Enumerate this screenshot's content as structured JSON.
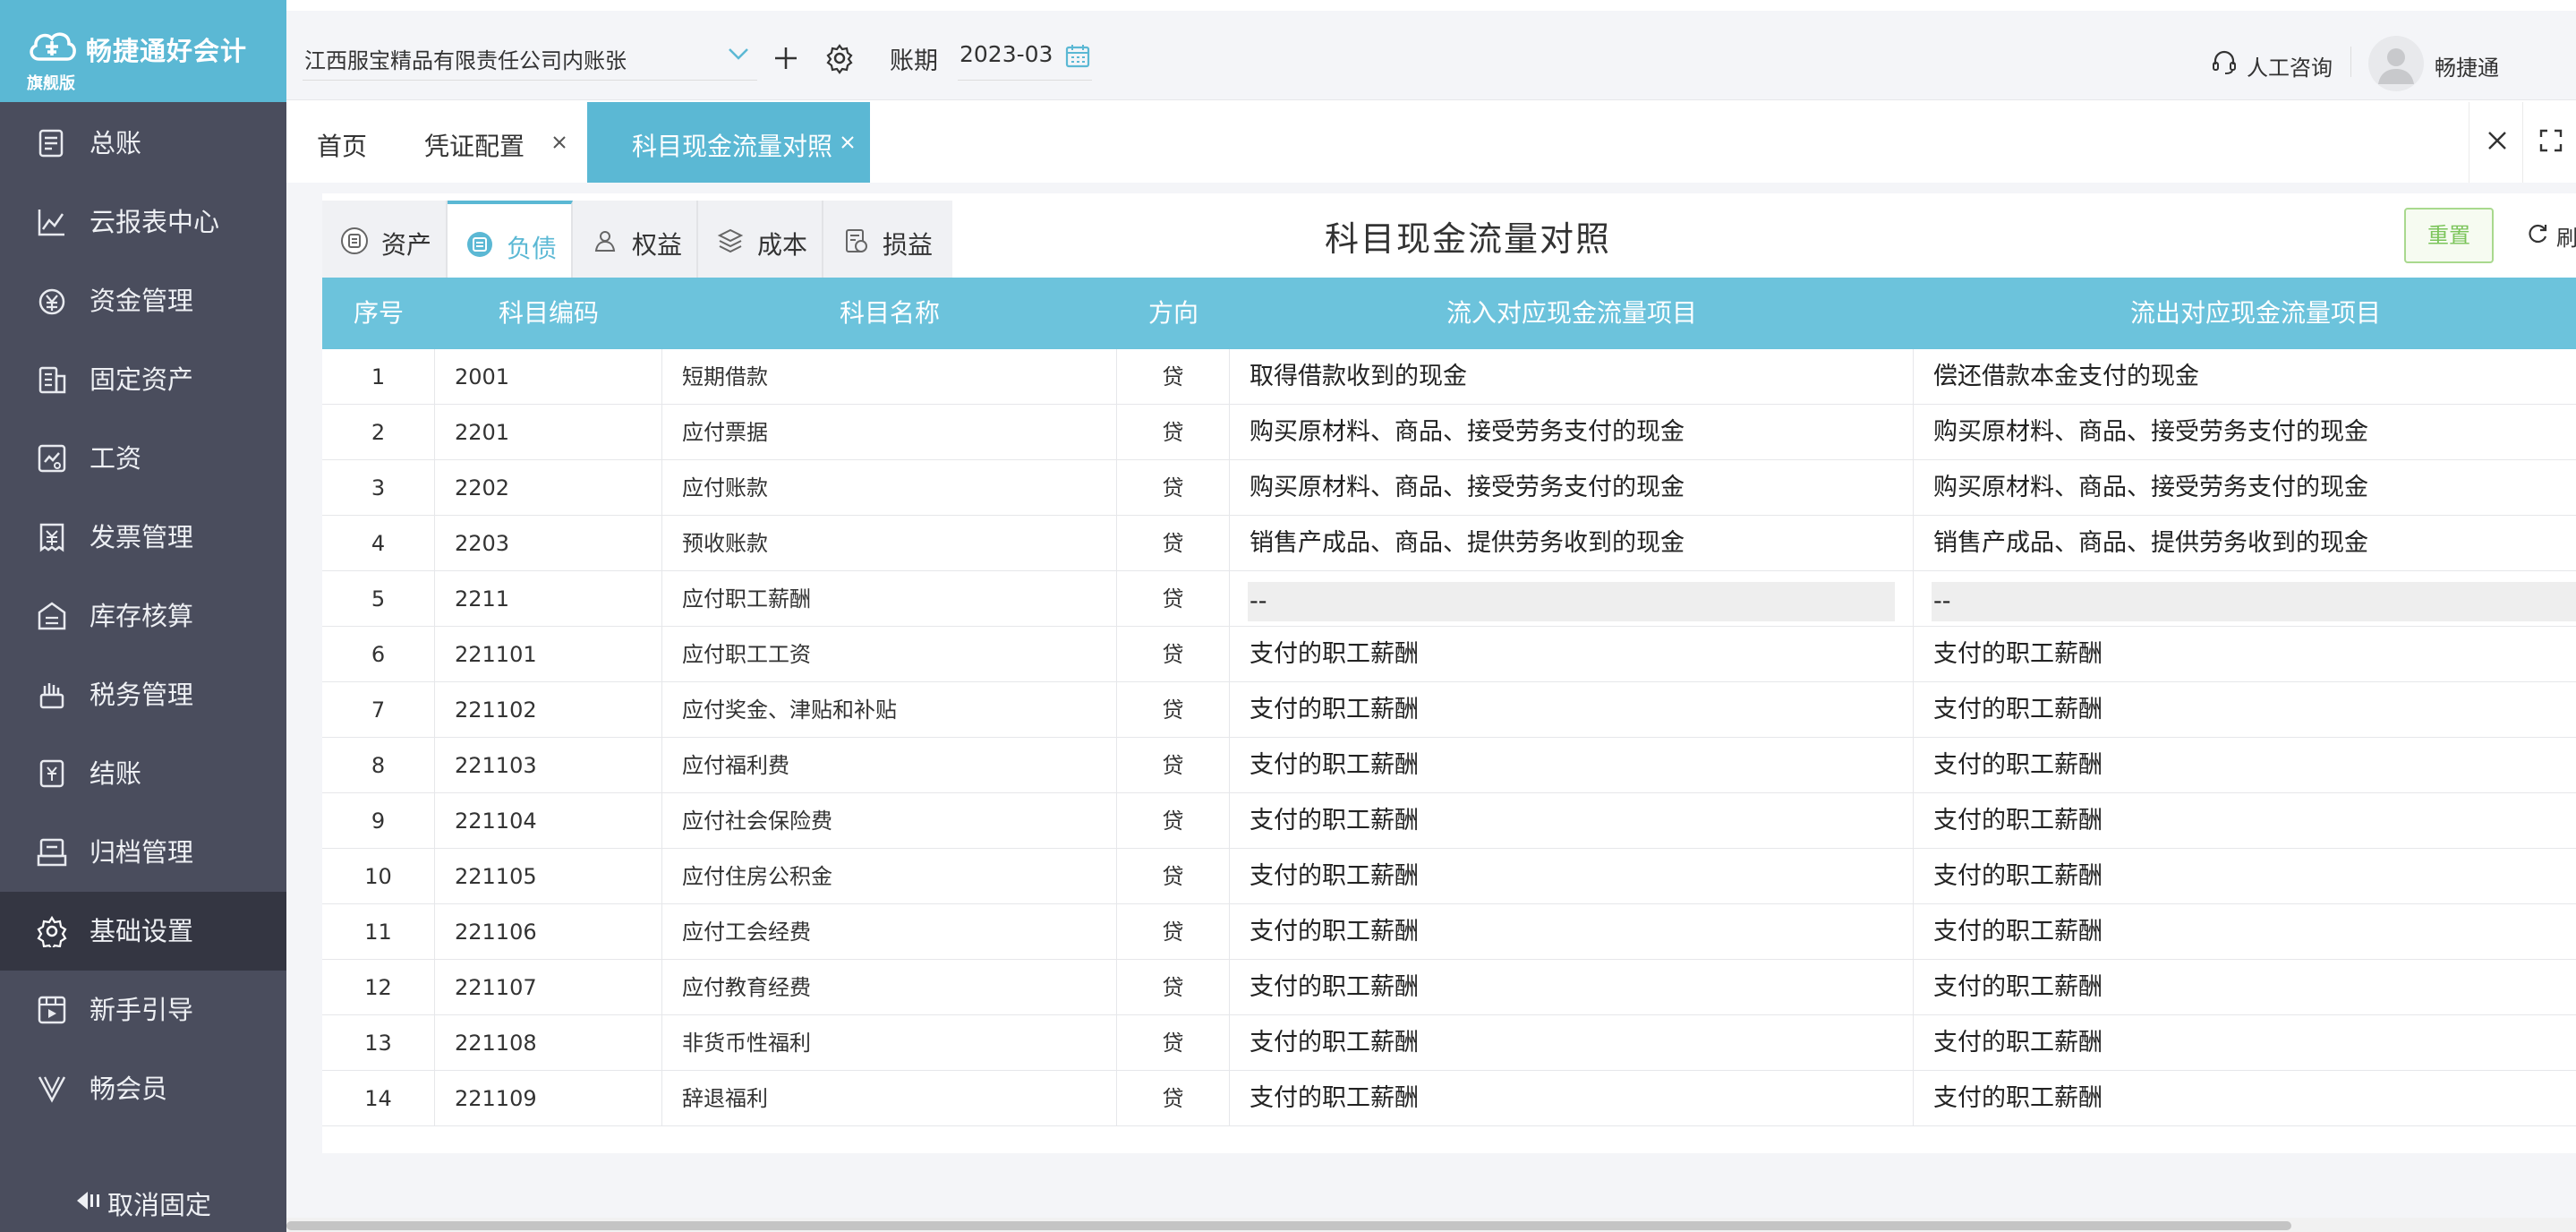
{
  "brand": {
    "name": "畅捷通好会计",
    "edition": "旗舰版"
  },
  "sidebar": {
    "items": [
      {
        "label": "总账",
        "icon": "ledger-icon"
      },
      {
        "label": "云报表中心",
        "icon": "chart-icon"
      },
      {
        "label": "资金管理",
        "icon": "money-icon"
      },
      {
        "label": "固定资产",
        "icon": "asset-icon"
      },
      {
        "label": "工资",
        "icon": "salary-icon"
      },
      {
        "label": "发票管理",
        "icon": "invoice-icon"
      },
      {
        "label": "库存核算",
        "icon": "warehouse-icon"
      },
      {
        "label": "税务管理",
        "icon": "tax-icon"
      },
      {
        "label": "结账",
        "icon": "closing-icon"
      },
      {
        "label": "归档管理",
        "icon": "archive-icon"
      },
      {
        "label": "基础设置",
        "icon": "gear-icon",
        "active": true
      },
      {
        "label": "新手引导",
        "icon": "guide-icon"
      },
      {
        "label": "畅会员",
        "icon": "vip-icon"
      }
    ],
    "unpin_label": "取消固定"
  },
  "topbar": {
    "company": "江西服宝精品有限责任公司内账张",
    "period_label": "账期",
    "period_value": "2023-03",
    "consult_label": "人工咨询",
    "user_name": "畅捷通"
  },
  "tabs": [
    {
      "label": "首页",
      "closable": false
    },
    {
      "label": "凭证配置",
      "closable": true
    },
    {
      "label": "科目现金流量对照",
      "closable": true,
      "active": true
    }
  ],
  "page": {
    "title": "科目现金流量对照",
    "reset_label": "重置",
    "refresh_label": "刷新",
    "categories": [
      {
        "label": "资产"
      },
      {
        "label": "负债",
        "active": true
      },
      {
        "label": "权益"
      },
      {
        "label": "成本"
      },
      {
        "label": "损益"
      }
    ]
  },
  "table": {
    "headers": [
      "序号",
      "科目编码",
      "科目名称",
      "方向",
      "流入对应现金流量项目",
      "流出对应现金流量项目"
    ],
    "rows": [
      [
        "1",
        "2001",
        "短期借款",
        "贷",
        "取得借款收到的现金",
        "偿还借款本金支付的现金"
      ],
      [
        "2",
        "2201",
        "应付票据",
        "贷",
        "购买原材料、商品、接受劳务支付的现金",
        "购买原材料、商品、接受劳务支付的现金"
      ],
      [
        "3",
        "2202",
        "应付账款",
        "贷",
        "购买原材料、商品、接受劳务支付的现金",
        "购买原材料、商品、接受劳务支付的现金"
      ],
      [
        "4",
        "2203",
        "预收账款",
        "贷",
        "销售产成品、商品、提供劳务收到的现金",
        "销售产成品、商品、提供劳务收到的现金"
      ],
      [
        "5",
        "2211",
        "应付职工薪酬",
        "贷",
        "--",
        "--"
      ],
      [
        "6",
        "221101",
        "应付职工工资",
        "贷",
        "支付的职工薪酬",
        "支付的职工薪酬"
      ],
      [
        "7",
        "221102",
        "应付奖金、津贴和补贴",
        "贷",
        "支付的职工薪酬",
        "支付的职工薪酬"
      ],
      [
        "8",
        "221103",
        "应付福利费",
        "贷",
        "支付的职工薪酬",
        "支付的职工薪酬"
      ],
      [
        "9",
        "221104",
        "应付社会保险费",
        "贷",
        "支付的职工薪酬",
        "支付的职工薪酬"
      ],
      [
        "10",
        "221105",
        "应付住房公积金",
        "贷",
        "支付的职工薪酬",
        "支付的职工薪酬"
      ],
      [
        "11",
        "221106",
        "应付工会经费",
        "贷",
        "支付的职工薪酬",
        "支付的职工薪酬"
      ],
      [
        "12",
        "221107",
        "应付教育经费",
        "贷",
        "支付的职工薪酬",
        "支付的职工薪酬"
      ],
      [
        "13",
        "221108",
        "非货币性福利",
        "贷",
        "支付的职工薪酬",
        "支付的职工薪酬"
      ],
      [
        "14",
        "221109",
        "辞退福利",
        "贷",
        "支付的职工薪酬",
        "支付的职工薪酬"
      ]
    ]
  },
  "colors": {
    "accent": "#5bb8d4",
    "sidebar": "#4a4d5d",
    "header_row": "#6cc3dc",
    "reset_green": "#7bc45a"
  }
}
